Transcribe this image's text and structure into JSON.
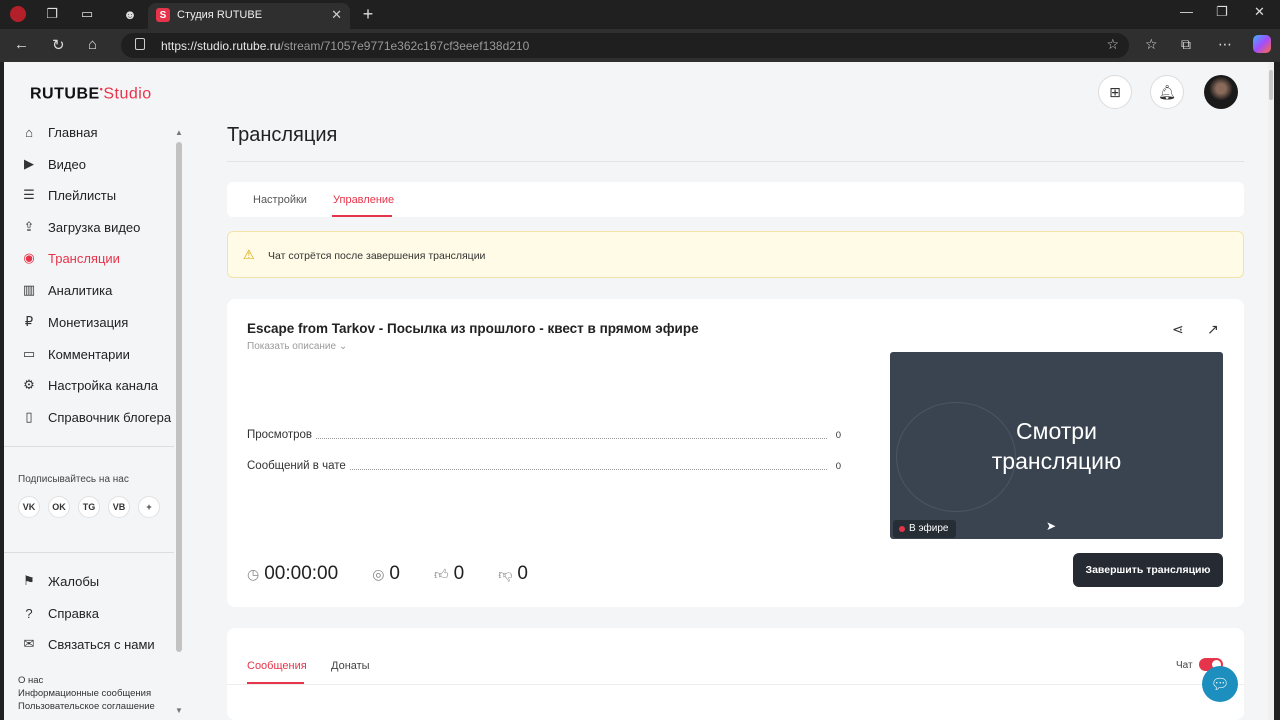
{
  "browser": {
    "tab_title": "Студия RUTUBE",
    "tab_favicon": "S",
    "url_host": "https://studio.rutube.ru",
    "url_path": "/stream/71057e9771e362c167cf3eeef138d210"
  },
  "header": {
    "logo_main": "RUTUBE",
    "logo_studio": "Studio",
    "logo_mark": "•"
  },
  "sidebar": {
    "items": [
      {
        "label": "Главная",
        "icon": "home-icon",
        "glyph": "⌂"
      },
      {
        "label": "Видео",
        "icon": "video-icon",
        "glyph": "▶"
      },
      {
        "label": "Плейлисты",
        "icon": "playlist-icon",
        "glyph": "☰"
      },
      {
        "label": "Загрузка видео",
        "icon": "upload-icon",
        "glyph": "⇪"
      },
      {
        "label": "Трансляции",
        "icon": "broadcast-icon",
        "glyph": "◉"
      },
      {
        "label": "Аналитика",
        "icon": "analytics-icon",
        "glyph": "▥"
      },
      {
        "label": "Монетизация",
        "icon": "monetization-icon",
        "glyph": "₽"
      },
      {
        "label": "Комментарии",
        "icon": "comments-icon",
        "glyph": "▭"
      },
      {
        "label": "Настройка канала",
        "icon": "gear-icon",
        "glyph": "⚙"
      },
      {
        "label": "Справочник блогера",
        "icon": "book-icon",
        "glyph": "▯"
      }
    ],
    "subscribe_label": "Подписывайтесь на нас",
    "social": [
      "VK",
      "OK",
      "TG",
      "VB",
      "+"
    ],
    "bottom_items": [
      {
        "label": "Жалобы",
        "icon": "flag-icon",
        "glyph": "⚑"
      },
      {
        "label": "Справка",
        "icon": "help-icon",
        "glyph": "?"
      },
      {
        "label": "Связаться с нами",
        "icon": "mail-icon",
        "glyph": "✉"
      }
    ],
    "footer_links": [
      "О нас",
      "Информационные сообщения",
      "Пользовательское соглашение"
    ]
  },
  "main": {
    "title": "Трансляция",
    "tabs": [
      "Настройки",
      "Управление"
    ],
    "active_tab": "Управление",
    "warning": "Чат сотрётся после завершения трансляции",
    "stream": {
      "title": "Escape from Tarkov - Посылка из прошлого - квест в прямом эфире",
      "show_description": "Показать описание",
      "stats": [
        {
          "label": "Просмотров",
          "value": "0"
        },
        {
          "label": "Сообщений в чате",
          "value": "0"
        }
      ],
      "timer": "00:00:00",
      "viewers": "0",
      "likes": "0",
      "dislikes": "0",
      "player_text_line1": "Смотри",
      "player_text_line2": "трансляцию",
      "live_badge": "В эфире",
      "end_button": "Завершить трансляцию"
    },
    "bottom_tabs": [
      "Сообщения",
      "Донаты"
    ],
    "chat_toggle_label": "Чат",
    "chat_enabled": true
  },
  "colors": {
    "accent": "#e6344a",
    "dark_button": "#252a33",
    "warning_bg": "#fffbe6"
  }
}
